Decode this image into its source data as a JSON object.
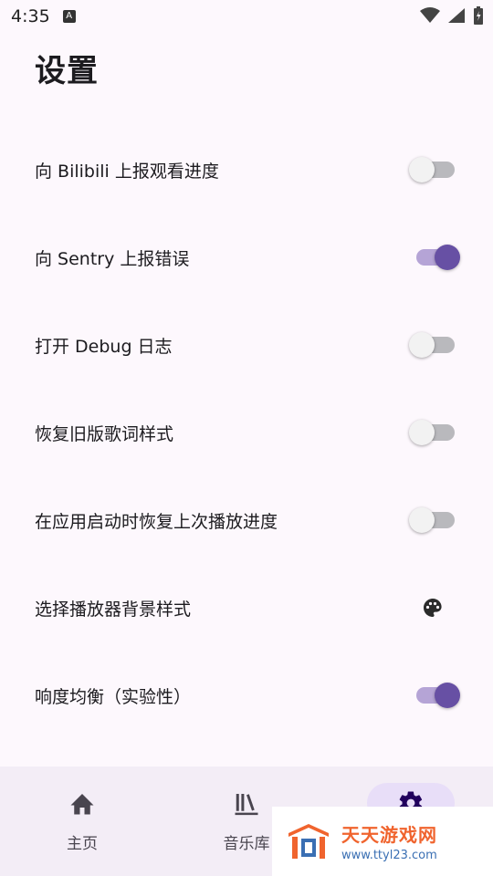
{
  "status_bar": {
    "time": "4:35",
    "notification_icon_glyph": "A",
    "icons": [
      "wifi-icon",
      "signal-icon",
      "battery-icon"
    ]
  },
  "page": {
    "title": "设置"
  },
  "settings": [
    {
      "label": "向 Bilibili 上报观看进度",
      "control": "switch",
      "on": false
    },
    {
      "label": "向 Sentry 上报错误",
      "control": "switch",
      "on": true
    },
    {
      "label": "打开 Debug 日志",
      "control": "switch",
      "on": false
    },
    {
      "label": "恢复旧版歌词样式",
      "control": "switch",
      "on": false
    },
    {
      "label": "在应用启动时恢复上次播放进度",
      "control": "switch",
      "on": false
    },
    {
      "label": "选择播放器背景样式",
      "control": "palette-icon"
    },
    {
      "label": "响度均衡（实验性）",
      "control": "switch",
      "on": true
    }
  ],
  "bottom_nav": {
    "items": [
      {
        "label": "主页",
        "icon": "home-icon",
        "active": false
      },
      {
        "label": "音乐库",
        "icon": "library-icon",
        "active": false
      },
      {
        "label": "",
        "icon": "settings-gear-icon",
        "active": true
      }
    ]
  },
  "watermark": {
    "title": "天天游戏网",
    "url": "www.ttyl23.com"
  },
  "colors": {
    "accent": "#6750a4",
    "accent_track": "#b5a4d6",
    "background": "#fdf8fd",
    "nav_background": "#f3edf6",
    "nav_active_pill": "#e8def8",
    "watermark_orange": "#f0642e",
    "watermark_blue": "#3a6fb3"
  }
}
